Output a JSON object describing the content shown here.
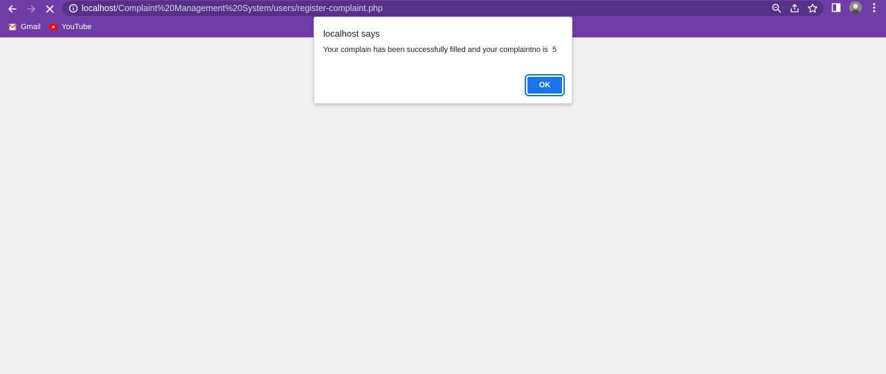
{
  "browser": {
    "url_host": "localhost",
    "url_path": "/Complaint%20Management%20System/users/register-complaint.php",
    "theme_color": "#6e3ea6",
    "omnibox_color": "#563188"
  },
  "bookmarks": [
    {
      "label": "Gmail",
      "icon": "gmail-icon"
    },
    {
      "label": "YouTube",
      "icon": "youtube-icon"
    }
  ],
  "dialog": {
    "title": "localhost says",
    "message": "Your complain has been successfully filled and your complaintno is  5",
    "ok_label": "OK",
    "button_color": "#1a73e8"
  }
}
